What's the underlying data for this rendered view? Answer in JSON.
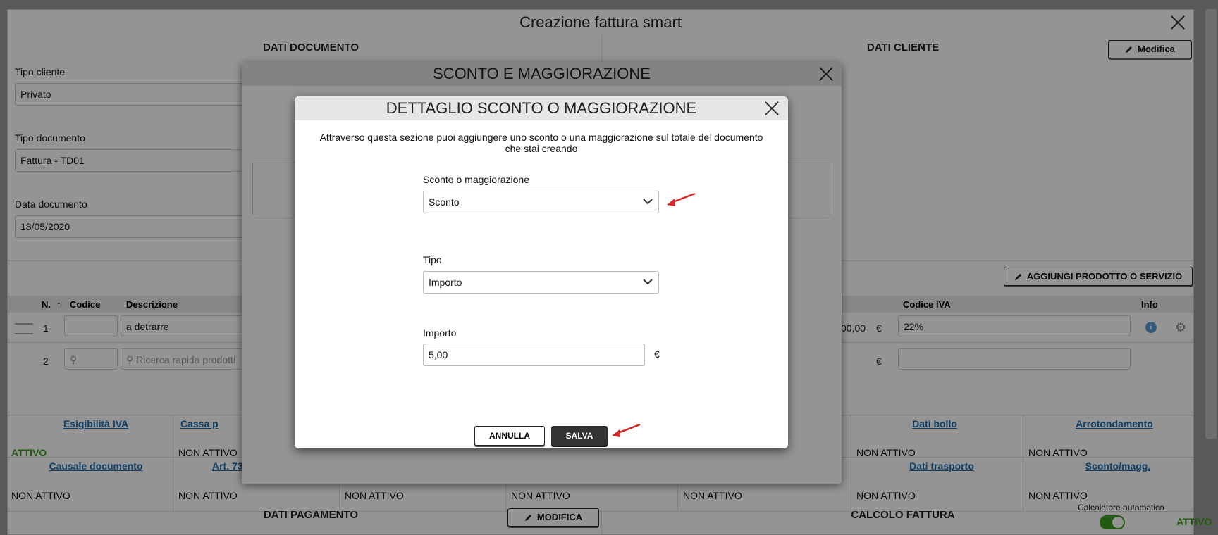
{
  "window": {
    "title": "Creazione fattura smart"
  },
  "dati_documento": {
    "title": "DATI DOCUMENTO",
    "tipo_cliente_label": "Tipo cliente",
    "tipo_cliente_value": "Privato",
    "tipo_documento_label": "Tipo documento",
    "tipo_documento_value": "Fattura - TD01",
    "data_documento_label": "Data documento",
    "data_documento_value": "18/05/2020"
  },
  "dati_cliente": {
    "title": "DATI CLIENTE",
    "modifica_label": "Modifica"
  },
  "prodotti": {
    "add_label": "AGGIUNGI PRODOTTO O SERVIZIO",
    "columns": {
      "n": "N.",
      "codice": "Codice",
      "descrizione": "Descrizione",
      "codice_iva": "Codice IVA",
      "info": "Info"
    },
    "rows": [
      {
        "n": "1",
        "descrizione": "a detrarre",
        "amount": "00,00",
        "currency": "€",
        "iva": "22%"
      },
      {
        "n": "2",
        "placeholder": "Ricerca rapida prodotti",
        "currency": "€"
      }
    ]
  },
  "options": {
    "esigibilita": {
      "label": "Esigibilità IVA",
      "status": "ATTIVO"
    },
    "cassa": {
      "label": "Cassa p",
      "status": "NON ATTIVO"
    },
    "dati_bollo": {
      "label": "Dati bollo",
      "status": "NON ATTIVO"
    },
    "arrotondamento": {
      "label": "Arrotondamento",
      "status": "NON ATTIVO"
    },
    "causale": {
      "label": "Causale documento",
      "status": "NON ATTIVO"
    },
    "art73": {
      "label": "Art. 73",
      "status": "NON ATTIVO"
    },
    "col3_status": "NON ATTIVO",
    "col4_status": "NON ATTIVO",
    "col5_status": "NON ATTIVO",
    "dati_trasporto": {
      "label": "Dati trasporto",
      "status": "NON ATTIVO"
    },
    "sconto_magg": {
      "label": "Sconto/magg.",
      "status": "NON ATTIVO"
    }
  },
  "footer": {
    "dati_pagamento": "DATI PAGAMENTO",
    "modifica_label": "MODIFICA",
    "calcolo_fattura": "CALCOLO FATTURA",
    "calcolatore_label": "Calcolatore automatico",
    "calcolatore_status": "ATTIVO"
  },
  "dialog1": {
    "title": "SCONTO E MAGGIORAZIONE"
  },
  "dialog2": {
    "title": "DETTAGLIO SCONTO O MAGGIORAZIONE",
    "description": "Attraverso questa sezione puoi aggiungere uno sconto o una maggiorazione sul totale del documento che stai creando",
    "sconto_label": "Sconto o maggiorazione",
    "sconto_value": "Sconto",
    "tipo_label": "Tipo",
    "tipo_value": "Importo",
    "importo_label": "Importo",
    "importo_value": "5,00",
    "currency": "€",
    "annulla_label": "ANNULLA",
    "salva_label": "SALVA"
  },
  "colors": {
    "accent_green": "#3c9c1c",
    "link_blue": "#1a6fb5",
    "arrow_red": "#d62828"
  }
}
